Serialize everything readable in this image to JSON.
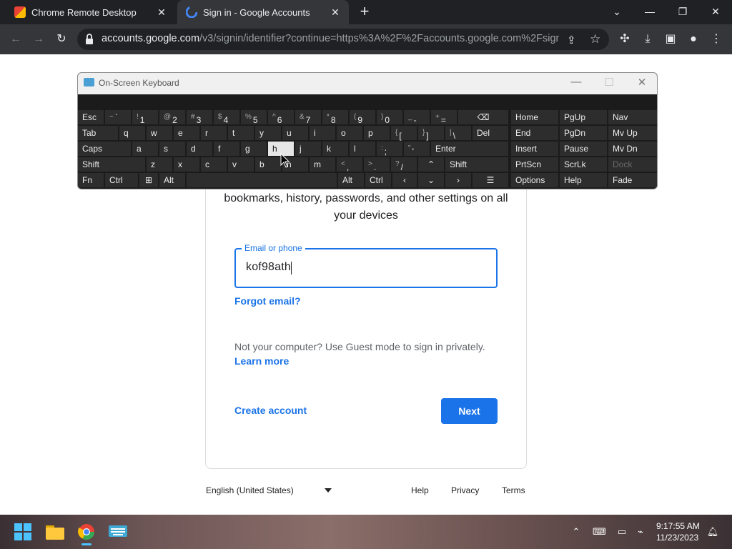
{
  "browser": {
    "tabs": [
      {
        "title": "Chrome Remote Desktop",
        "active": false
      },
      {
        "title": "Sign in - Google Accounts",
        "active": true
      }
    ],
    "url_host": "accounts.google.com",
    "url_path": "/v3/signin/identifier?continue=https%3A%2F%2Faccounts.google.com%2Fsignin..."
  },
  "signin": {
    "subtitle": "bookmarks, history, passwords, and other settings on all your devices",
    "email_label": "Email or phone",
    "email_value": "kof98ath",
    "forgot_email": "Forgot email?",
    "guest_text": "Not your computer? Use Guest mode to sign in privately.",
    "learn_more": "Learn more",
    "create_account": "Create account",
    "next": "Next"
  },
  "footer": {
    "language": "English (United States)",
    "help": "Help",
    "privacy": "Privacy",
    "terms": "Terms"
  },
  "osk": {
    "title": "On-Screen Keyboard",
    "keys": {
      "esc": "Esc",
      "tab": "Tab",
      "caps": "Caps",
      "shift": "Shift",
      "fn": "Fn",
      "ctrl": "Ctrl",
      "alt": "Alt",
      "del": "Del",
      "enter": "Enter",
      "shift_r": "Shift",
      "alt_r": "Alt",
      "ctrl_r": "Ctrl",
      "home": "Home",
      "pgup": "PgUp",
      "nav": "Nav",
      "end": "End",
      "pgdn": "PgDn",
      "mvup": "Mv Up",
      "insert": "Insert",
      "pause": "Pause",
      "mvdn": "Mv Dn",
      "prtscn": "PrtScn",
      "scrlk": "ScrLk",
      "dock": "Dock",
      "options": "Options",
      "help": "Help",
      "fade": "Fade"
    },
    "highlighted_key": "h"
  },
  "taskbar": {
    "time": "9:17:55 AM",
    "date": "11/23/2023"
  },
  "colors": {
    "accent": "#1a73e8",
    "browser_dark": "#202124",
    "toolbar": "#35363a",
    "key": "#2d2d2d"
  }
}
